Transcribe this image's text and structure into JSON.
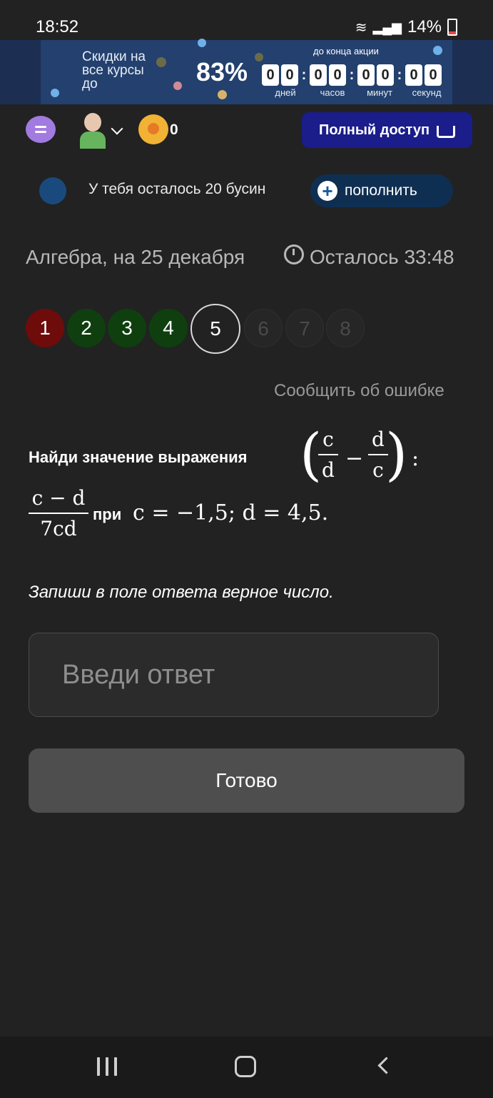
{
  "status_bar": {
    "time": "18:52",
    "battery": "14%"
  },
  "banner": {
    "text": "Скидки на все курсы до",
    "percent": "83%",
    "countdown_caption": "до конца акции",
    "digits": [
      "0",
      "0",
      "0",
      "0",
      "0",
      "0",
      "0",
      "0"
    ],
    "units": [
      "дней",
      "часов",
      "минут",
      "секунд"
    ]
  },
  "toolbar": {
    "coins": "0",
    "full_access_label": "Полный доступ"
  },
  "beads": {
    "text": "У тебя осталось 20 бусин",
    "topup_label": "пополнить"
  },
  "test": {
    "subject": "Алгебра, на 25 декабря",
    "timer": "Осталось 33:48",
    "questions": [
      {
        "n": "1",
        "state": "wrong"
      },
      {
        "n": "2",
        "state": "right"
      },
      {
        "n": "3",
        "state": "right"
      },
      {
        "n": "4",
        "state": "right"
      },
      {
        "n": "5",
        "state": "current"
      },
      {
        "n": "6",
        "state": "future"
      },
      {
        "n": "7",
        "state": "future"
      },
      {
        "n": "8",
        "state": "future"
      }
    ],
    "report_label": "Сообщить об ошибке"
  },
  "problem": {
    "task": "Найди значение выражения",
    "frac1_num": "c",
    "frac1_den": "d",
    "frac2_num": "d",
    "frac2_den": "c",
    "divide": ":",
    "frac3_num": "c − d",
    "frac3_den": "7cd",
    "minus": "−",
    "condition_label": "при",
    "condition": "c = −1,5;  d = 4,5.",
    "instruction": "Запиши в поле ответа верное число."
  },
  "answer": {
    "placeholder": "Введи ответ",
    "value": ""
  },
  "submit_label": "Готово",
  "colors": {
    "background": "#222222",
    "wrong": "#6e0b0b",
    "right": "#0f3f0f",
    "accent": "#1a1d8a"
  }
}
